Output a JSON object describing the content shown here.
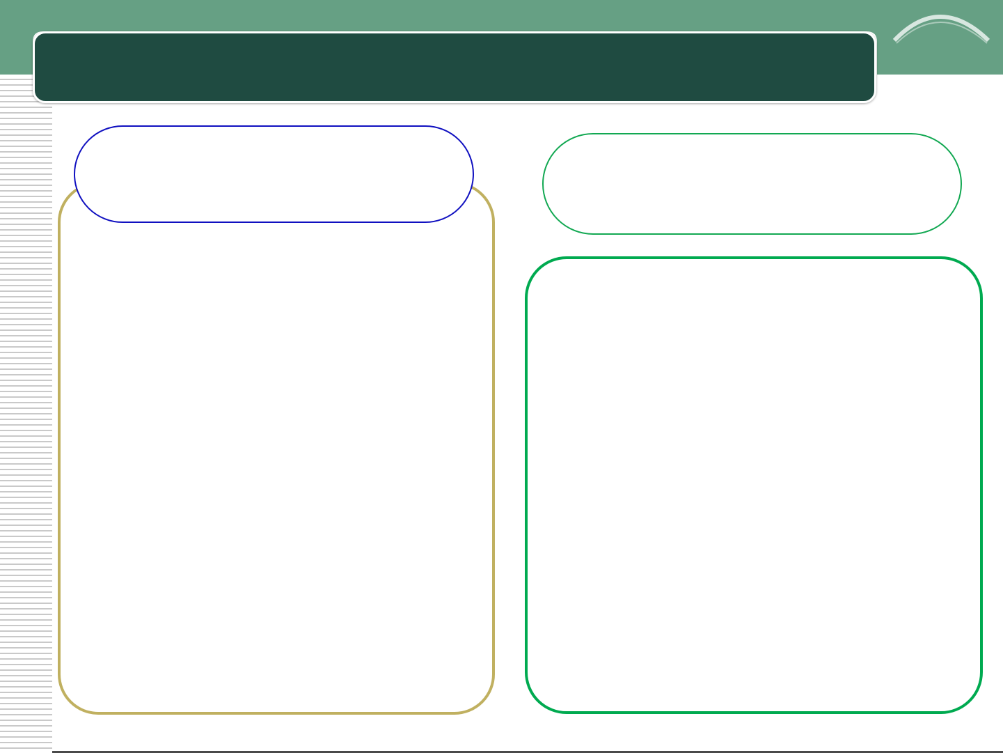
{
  "slide": {
    "title": "",
    "left": {
      "heading": "",
      "body": ""
    },
    "right": {
      "heading": "",
      "body": ""
    }
  },
  "colors": {
    "top_band": "#66a084",
    "title_bar": "#1f4b41",
    "left_panel_border": "#c0b060",
    "left_pill_border": "#1010c0",
    "right_pill_border": "#12a852",
    "right_panel_border": "#00aa50",
    "stripes": "#c9c9c9"
  }
}
